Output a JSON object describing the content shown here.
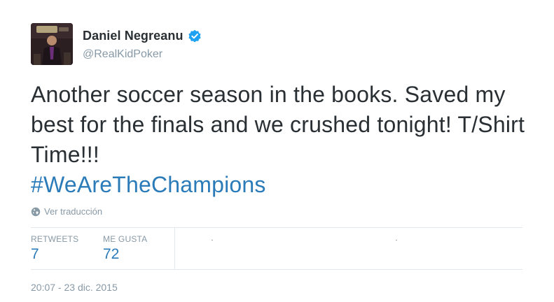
{
  "user": {
    "display_name": "Daniel Negreanu",
    "handle": "@RealKidPoker",
    "verified": true,
    "avatar_icon": "profile-photo"
  },
  "tweet": {
    "text_line": "Another soccer season in the books. Saved my best for the finals and we crushed tonight! T/Shirt Time!!!",
    "hashtag": "#WeAreTheChampions",
    "hashtag_color": "#2b7bb9"
  },
  "translate": {
    "icon": "globe-icon",
    "label": "Ver traducción"
  },
  "stats": {
    "retweets_label": "RETWEETS",
    "retweets_count": "7",
    "likes_label": "ME GUSTA",
    "likes_count": "72"
  },
  "timestamp": "20:07 - 23 dic. 2015",
  "colors": {
    "text": "#292f33",
    "muted": "#8899a6",
    "link": "#2b7bb9",
    "border": "#e1e8ed",
    "verified": "#1da1f2"
  }
}
